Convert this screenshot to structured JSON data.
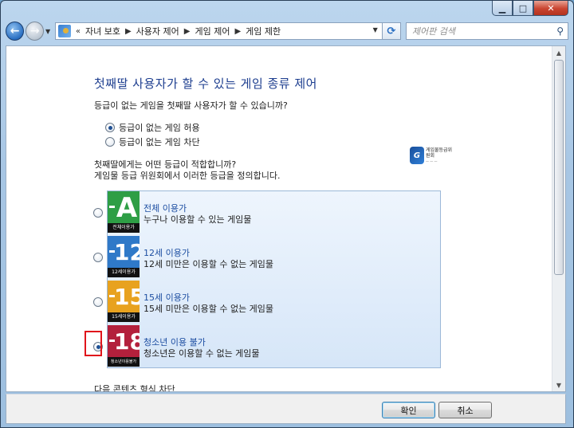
{
  "nav": {
    "breadcrumb": [
      "자녀 보호",
      "사용자 제어",
      "게임 제어",
      "게임 제한"
    ],
    "search_placeholder": "제어판 검색"
  },
  "page": {
    "title": "첫째딸 사용자가 할 수 있는 게임 종류 제어",
    "question_unrated": "등급이 없는 게임을 첫째딸 사용자가 할 수 있습니까?",
    "unrated_options": [
      {
        "label": "등급이 없는 게임 허용",
        "selected": true
      },
      {
        "label": "등급이 없는 게임 차단",
        "selected": false
      }
    ],
    "question_rating_line1": "첫째딸에게는 어떤 등급이 적합합니까?",
    "question_rating_line2": "게임물 등급 위원회에서 이러한 등급을 정의합니다.",
    "board_logo_text": "게임물등급위원회",
    "ratings": [
      {
        "glyph": "A",
        "icon_caption": "전체이용가",
        "title": "전체 이용가",
        "description": "누구나 이용할 수 있는 게임물",
        "color": "#2e9e45",
        "selected": false
      },
      {
        "glyph": "12",
        "icon_caption": "12세이용가",
        "title": "12세 이용가",
        "description": "12세 미만은 이용할 수 없는 게임물",
        "color": "#2f79c8",
        "selected": false
      },
      {
        "glyph": "15",
        "icon_caption": "15세이용가",
        "title": "15세 이용가",
        "description": "15세 미만은 이용할 수 없는 게임물",
        "color": "#e8a21f",
        "selected": false
      },
      {
        "glyph": "18",
        "icon_caption": "청소년이용불가",
        "title": "청소년 이용 불가",
        "description": "청소년은 이용할 수 없는 게임물",
        "color": "#b3203c",
        "selected": true
      }
    ],
    "block_content_label": "다음 콘텐츠 형식 차단"
  },
  "buttons": {
    "ok": "확인",
    "cancel": "취소"
  }
}
